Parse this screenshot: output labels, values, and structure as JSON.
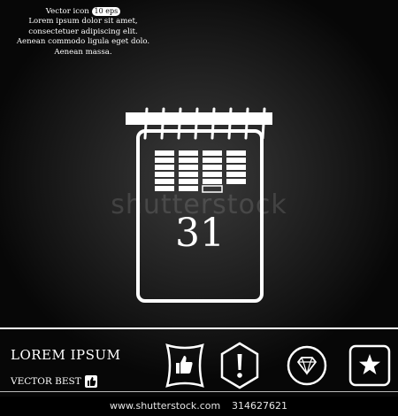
{
  "caption": {
    "line1_prefix": "Vector icon",
    "badge": "10 eps",
    "line2": "Lorem ipsum dolor sit amet,",
    "line3": "consectetuer adipiscing elit.",
    "line4": "Aenean commodo ligula eget dolo.",
    "line5": "Aenean massa."
  },
  "calendar": {
    "day_number": "31"
  },
  "watermark": {
    "text": "shutterstock"
  },
  "brand": {
    "title": "LOREM IPSUM",
    "subtitle": "VECTOR BEST"
  },
  "icons": [
    "thumbs-up-icon",
    "exclamation-icon",
    "diamond-icon",
    "star-icon"
  ],
  "footer": {
    "url": "www.shutterstock.com",
    "stock_id": "314627621"
  },
  "colors": {
    "foreground": "#ffffff",
    "background": "#000000"
  }
}
